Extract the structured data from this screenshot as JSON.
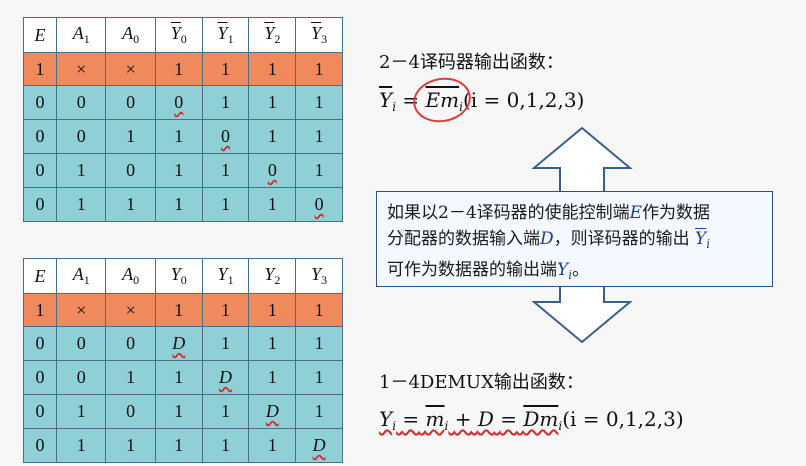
{
  "table1": {
    "headers": [
      "E",
      "A",
      "1",
      "A",
      "0",
      "Y",
      "0",
      "Y",
      "1",
      "Y",
      "2",
      "Y",
      "3"
    ],
    "rows": [
      [
        "1",
        "×",
        "×",
        "1",
        "1",
        "1",
        "1"
      ],
      [
        "0",
        "0",
        "0",
        "0",
        "1",
        "1",
        "1"
      ],
      [
        "0",
        "0",
        "1",
        "1",
        "0",
        "1",
        "1"
      ],
      [
        "0",
        "1",
        "0",
        "1",
        "1",
        "0",
        "1"
      ],
      [
        "0",
        "1",
        "1",
        "1",
        "1",
        "1",
        "0"
      ]
    ]
  },
  "table2": {
    "headers": [
      "E",
      "A",
      "1",
      "A",
      "0",
      "Y",
      "0",
      "Y",
      "1",
      "Y",
      "2",
      "Y",
      "3"
    ],
    "rows": [
      [
        "1",
        "×",
        "×",
        "1",
        "1",
        "1",
        "1"
      ],
      [
        "0",
        "0",
        "0",
        "D",
        "1",
        "1",
        "1"
      ],
      [
        "0",
        "0",
        "1",
        "1",
        "D",
        "1",
        "1"
      ],
      [
        "0",
        "1",
        "0",
        "1",
        "1",
        "D",
        "1"
      ],
      [
        "0",
        "1",
        "1",
        "1",
        "1",
        "1",
        "D"
      ]
    ]
  },
  "decoder_title": "2－4译码器输出函数：",
  "decoder_formula": {
    "lhs": "Y",
    "sub": "i",
    "eq": "=",
    "rhs": "Em",
    "rhs_sub": "i",
    "range": "(i = 0,1,2,3)"
  },
  "callout": {
    "line1a": "如果以2－4译码器的使能控制端",
    "E": "E",
    "line1b": "作为数据",
    "line2a": "分配器的数据输入端",
    "D": "D",
    "line2b": "，则译码器的输出",
    "Yi": "Y",
    "Yi_sub": "i",
    "line3a": "可作为数据器的输出端",
    "Yi2": "Y",
    "Yi2_sub": "i",
    "line3b": "。"
  },
  "demux_title": "1－4DEMUX输出函数：",
  "demux_formula": {
    "lhs": "Y",
    "sub": "i",
    "eq1": "=",
    "m": "m",
    "m_sub": "i",
    "plus": "+",
    "D": "D",
    "eq2": "=",
    "Dm": "Dm",
    "Dm_sub": "i",
    "range": "(i = 0,1,2,3)"
  }
}
